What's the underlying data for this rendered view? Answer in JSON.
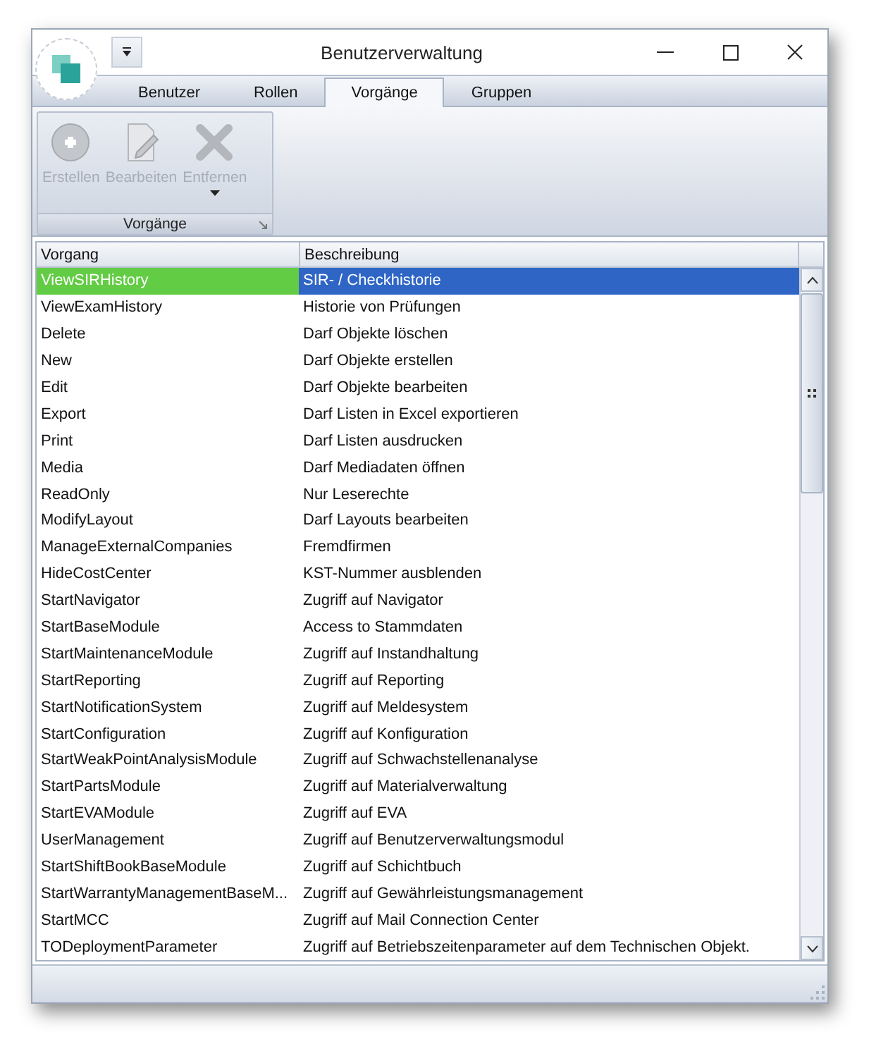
{
  "window": {
    "title": "Benutzerverwaltung"
  },
  "tabs": [
    {
      "label": "Benutzer",
      "selected": false
    },
    {
      "label": "Rollen",
      "selected": false
    },
    {
      "label": "Vorgänge",
      "selected": true
    },
    {
      "label": "Gruppen",
      "selected": false
    }
  ],
  "ribbon": {
    "group": "Vorgänge",
    "buttons": [
      {
        "kind": "add",
        "label": "Erstellen",
        "disabled": true
      },
      {
        "kind": "edit",
        "label": "Bearbeiten",
        "disabled": true
      },
      {
        "kind": "remove",
        "label": "Entfernen",
        "disabled": true,
        "dropdown": true
      }
    ]
  },
  "table": {
    "columns": [
      "Vorgang",
      "Beschreibung"
    ],
    "rows": [
      {
        "cells": [
          "ViewSIRHistory",
          "SIR- / Checkhistorie"
        ],
        "selected": true
      },
      {
        "cells": [
          "ViewExamHistory",
          "Historie von Prüfungen"
        ],
        "selected": false
      },
      {
        "cells": [
          "Delete",
          "Darf Objekte löschen"
        ],
        "selected": false
      },
      {
        "cells": [
          "New",
          "Darf Objekte erstellen"
        ],
        "selected": false
      },
      {
        "cells": [
          "Edit",
          "Darf Objekte bearbeiten"
        ],
        "selected": false
      },
      {
        "cells": [
          "Export",
          "Darf Listen in Excel exportieren"
        ],
        "selected": false
      },
      {
        "cells": [
          "Print",
          "Darf Listen ausdrucken"
        ],
        "selected": false
      },
      {
        "cells": [
          "Media",
          "Darf Mediadaten öffnen"
        ],
        "selected": false
      },
      {
        "cells": [
          "ReadOnly",
          "Nur Leserechte"
        ],
        "selected": false
      },
      {
        "cells": [
          "ModifyLayout",
          "Darf Layouts bearbeiten"
        ],
        "selected": false
      },
      {
        "cells": [
          "ManageExternalCompanies",
          "Fremdfirmen"
        ],
        "selected": false
      },
      {
        "cells": [
          "HideCostCenter",
          "KST-Nummer ausblenden"
        ],
        "selected": false
      },
      {
        "cells": [
          "StartNavigator",
          "Zugriff auf Navigator"
        ],
        "selected": false
      },
      {
        "cells": [
          "StartBaseModule",
          "Access to Stammdaten"
        ],
        "selected": false
      },
      {
        "cells": [
          "StartMaintenanceModule",
          "Zugriff auf Instandhaltung"
        ],
        "selected": false
      },
      {
        "cells": [
          "StartReporting",
          "Zugriff auf Reporting"
        ],
        "selected": false
      },
      {
        "cells": [
          "StartNotificationSystem",
          "Zugriff auf Meldesystem"
        ],
        "selected": false
      },
      {
        "cells": [
          "StartConfiguration",
          "Zugriff auf Konfiguration"
        ],
        "selected": false
      },
      {
        "cells": [
          "StartWeakPointAnalysisModule",
          "Zugriff auf Schwachstellenanalyse"
        ],
        "selected": false
      },
      {
        "cells": [
          "StartPartsModule",
          "Zugriff auf Materialverwaltung"
        ],
        "selected": false
      },
      {
        "cells": [
          "StartEVAModule",
          "Zugriff auf EVA"
        ],
        "selected": false
      },
      {
        "cells": [
          "UserManagement",
          "Zugriff auf Benutzerverwaltungsmodul"
        ],
        "selected": false
      },
      {
        "cells": [
          "StartShiftBookBaseModule",
          "Zugriff auf Schichtbuch"
        ],
        "selected": false
      },
      {
        "cells": [
          "StartWarrantyManagementBaseM...",
          "Zugriff auf Gewährleistungsmanagement"
        ],
        "selected": false
      },
      {
        "cells": [
          "StartMCC",
          "Zugriff auf Mail Connection Center"
        ],
        "selected": false
      },
      {
        "cells": [
          "TODeploymentParameter",
          "Zugriff auf Betriebszeitenparameter auf dem Technischen Objekt."
        ],
        "selected": false
      }
    ]
  }
}
